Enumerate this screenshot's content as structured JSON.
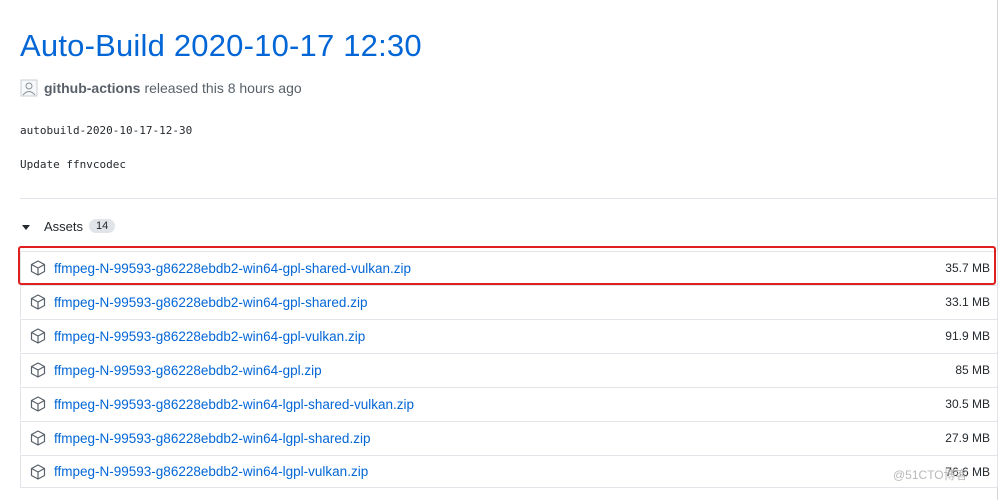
{
  "release": {
    "title": "Auto-Build 2020-10-17 12:30",
    "author": "github-actions",
    "released_text": "released this 8 hours ago",
    "tag": "autobuild-2020-10-17-12-30",
    "notes": "Update ffnvcodec"
  },
  "assets": {
    "label": "Assets",
    "count": "14",
    "items": [
      {
        "name": "ffmpeg-N-99593-g86228ebdb2-win64-gpl-shared-vulkan.zip",
        "size": "35.7 MB"
      },
      {
        "name": "ffmpeg-N-99593-g86228ebdb2-win64-gpl-shared.zip",
        "size": "33.1 MB"
      },
      {
        "name": "ffmpeg-N-99593-g86228ebdb2-win64-gpl-vulkan.zip",
        "size": "91.9 MB"
      },
      {
        "name": "ffmpeg-N-99593-g86228ebdb2-win64-gpl.zip",
        "size": "85 MB"
      },
      {
        "name": "ffmpeg-N-99593-g86228ebdb2-win64-lgpl-shared-vulkan.zip",
        "size": "30.5 MB"
      },
      {
        "name": "ffmpeg-N-99593-g86228ebdb2-win64-lgpl-shared.zip",
        "size": "27.9 MB"
      },
      {
        "name": "ffmpeg-N-99593-g86228ebdb2-win64-lgpl-vulkan.zip",
        "size": "76.6 MB"
      }
    ]
  },
  "watermark": "@51CTO博客",
  "colors": {
    "link": "#0366d6",
    "highlight": "#e0201f",
    "border": "#e1e4e8"
  },
  "icons": {
    "asset": "package-icon",
    "toggle": "caret-down-icon",
    "avatar": "avatar-icon"
  }
}
